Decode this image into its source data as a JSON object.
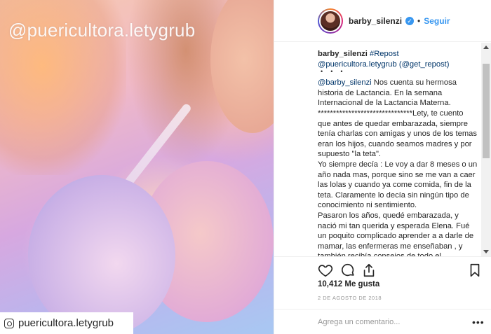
{
  "media": {
    "watermark_handle": "@puericultora.letygrub",
    "watermark_tag": "puericultora.letygrub"
  },
  "header": {
    "username": "barby_silenzi",
    "separator": "•",
    "follow_label": "Seguir"
  },
  "caption": {
    "author": "barby_silenzi",
    "repost_tag": "#Repost",
    "reposted_user": "@puericultora.letygrub",
    "get_repost": "(@get_repost)",
    "dots": "・・・",
    "mention": "@barby_silenzi",
    "body_1": "Nos cuenta su hermosa historia de Lactancia. En la semana Internacional de la Lactancia Materna. *******************************Lety, te cuento que antes de quedar embarazada, siempre tenía charlas con amigas y unos de los temas eran los hijos, cuando seamos madres y por supuesto \"la teta\".",
    "body_2": "Yo siempre decía : Le voy a dar 8 meses o un año nada mas, porque sino se me van a caer las lolas y cuando ya come comida, fin de la teta. Claramente lo decía sin ningún tipo de conocimiento ni sentimiento.",
    "body_3": "Pasaron los años, quedé embarazada, y nació mi tan querida y esperada Elena. Fué un poquito complicado aprender a a darle de mamar, las enfermeras me enseñaban , y también recibía consejos de todo el"
  },
  "actions": {
    "icons": [
      "heart-icon",
      "comment-icon",
      "share-icon",
      "bookmark-icon"
    ]
  },
  "likes_text": "10,412 Me gusta",
  "date_text": "2 DE AGOSTO DE 2018",
  "comment": {
    "placeholder": "Agrega un comentario...",
    "more_label": "•••"
  },
  "colors": {
    "link": "#3897f0",
    "mention": "#003569",
    "muted": "#999999"
  }
}
